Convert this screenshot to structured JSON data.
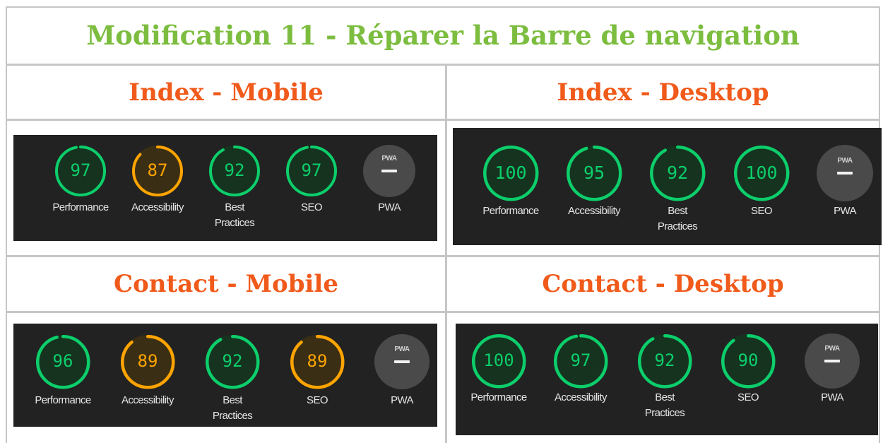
{
  "title": "Modification 11 - Réparer la Barre de navigation",
  "sections": [
    {
      "id": "index-mobile",
      "title": "Index - Mobile",
      "gauges": [
        {
          "score": 97,
          "label": [
            "Performance"
          ],
          "status": "pass"
        },
        {
          "score": 87,
          "label": [
            "Accessibility"
          ],
          "status": "average"
        },
        {
          "score": 92,
          "label": [
            "Best",
            "Practices"
          ],
          "status": "pass"
        },
        {
          "score": 97,
          "label": [
            "SEO"
          ],
          "status": "pass"
        },
        {
          "pwa": true,
          "tag": "PWA",
          "label": [
            "PWA"
          ]
        }
      ]
    },
    {
      "id": "index-desktop",
      "title": "Index - Desktop",
      "gauges": [
        {
          "score": 100,
          "label": [
            "Performance"
          ],
          "status": "pass"
        },
        {
          "score": 95,
          "label": [
            "Accessibility"
          ],
          "status": "pass"
        },
        {
          "score": 92,
          "label": [
            "Best",
            "Practices"
          ],
          "status": "pass"
        },
        {
          "score": 100,
          "label": [
            "SEO"
          ],
          "status": "pass"
        },
        {
          "pwa": true,
          "tag": "PWA",
          "label": [
            "PWA"
          ]
        }
      ]
    },
    {
      "id": "contact-mobile",
      "title": "Contact - Mobile",
      "gauges": [
        {
          "score": 96,
          "label": [
            "Performance"
          ],
          "status": "pass"
        },
        {
          "score": 89,
          "label": [
            "Accessibility"
          ],
          "status": "average"
        },
        {
          "score": 92,
          "label": [
            "Best",
            "Practices"
          ],
          "status": "pass"
        },
        {
          "score": 89,
          "label": [
            "SEO"
          ],
          "status": "average"
        },
        {
          "pwa": true,
          "tag": "PWA",
          "label": [
            "PWA"
          ]
        }
      ]
    },
    {
      "id": "contact-desktop",
      "title": "Contact - Desktop",
      "gauges": [
        {
          "score": 100,
          "label": [
            "Performance"
          ],
          "status": "pass"
        },
        {
          "score": 97,
          "label": [
            "Accessibility"
          ],
          "status": "pass"
        },
        {
          "score": 92,
          "label": [
            "Best",
            "Practices"
          ],
          "status": "pass"
        },
        {
          "score": 90,
          "label": [
            "SEO"
          ],
          "status": "pass"
        },
        {
          "pwa": true,
          "tag": "PWA",
          "label": [
            "PWA"
          ]
        }
      ]
    }
  ],
  "colors": {
    "title": "#7cbd3f",
    "section_title": "#f05a1a",
    "pass": "#0cce6b",
    "pass_fill": "#16331f",
    "average": "#ffa400",
    "average_fill": "#3a2e14",
    "panel_bg": "#222222",
    "pwa_circle": "#4a4a4a"
  }
}
